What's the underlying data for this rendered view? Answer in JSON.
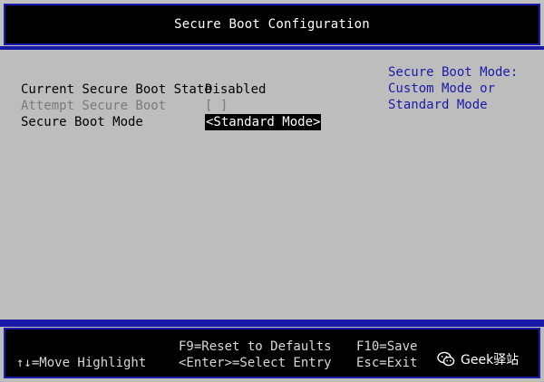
{
  "header": {
    "title": "Secure Boot Configuration"
  },
  "settings": [
    {
      "label": "Current Secure Boot State",
      "value": "Disabled"
    },
    {
      "label": "Attempt Secure Boot",
      "value": "[ ]"
    },
    {
      "label": "Secure Boot Mode",
      "value": "<Standard Mode>"
    }
  ],
  "help": {
    "lines": [
      "Secure Boot Mode:",
      "Custom Mode or",
      "Standard Mode"
    ]
  },
  "footer": {
    "move": "↑↓=Move Highlight",
    "reset": "F9=Reset to Defaults",
    "select": "<Enter>=Select Entry",
    "save": "F10=Save",
    "exit": "Esc=Exit"
  },
  "watermark": {
    "text": "Geek驿站",
    "icon": "wechat-icon"
  },
  "colors": {
    "background": "#bdbdbd",
    "accent_blue": "#1a1aa8",
    "bar_black": "#000000",
    "disabled_text": "#7a7a7a"
  }
}
